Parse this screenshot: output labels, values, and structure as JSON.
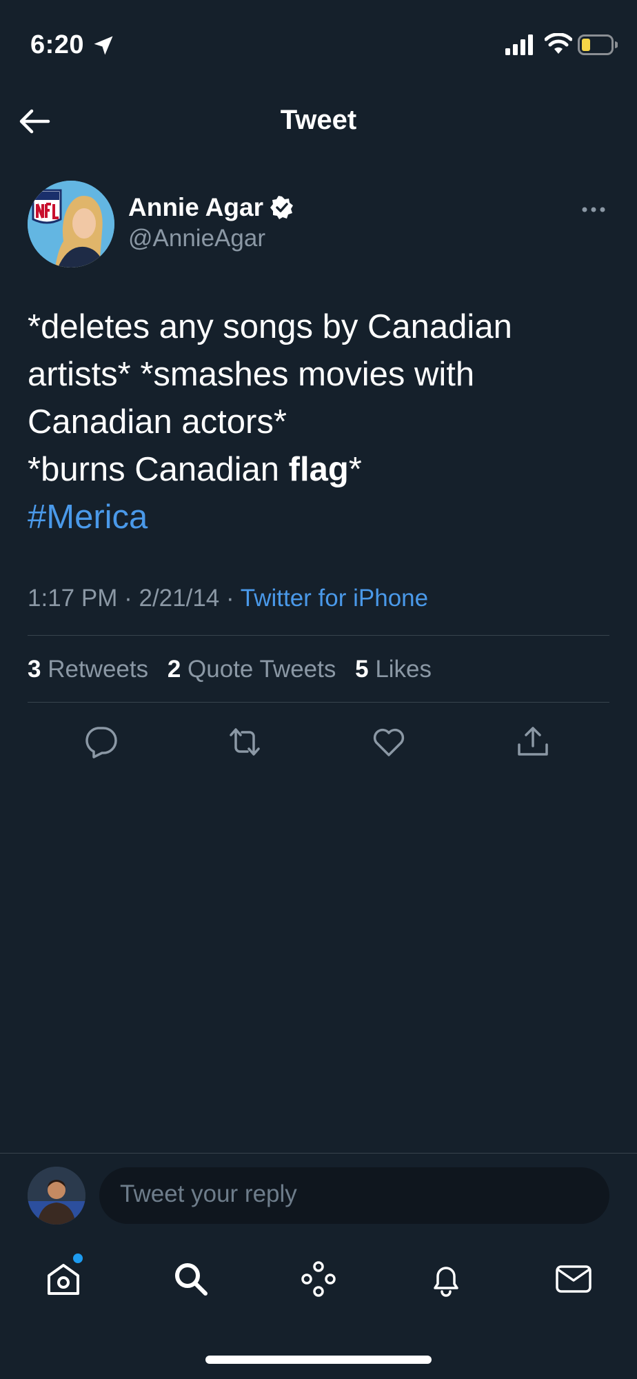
{
  "status_bar": {
    "time": "6:20",
    "icons": [
      "location-arrow-icon",
      "cellular-signal-icon",
      "wifi-icon",
      "battery-low-icon"
    ],
    "battery_color": "#f5d547"
  },
  "header": {
    "title": "Tweet",
    "back_icon": "arrow-left-icon"
  },
  "tweet": {
    "author_name": "Annie Agar",
    "author_handle": "@AnnieAgar",
    "verified": true,
    "text_lines": [
      "*deletes any songs by Canadian",
      "artists* *smashes movies with",
      "Canadian actors*"
    ],
    "line4_before": "*burns Canadian ",
    "line4_bold": "flag",
    "line4_after": "*",
    "hashtag": "#Merica",
    "time": "1:17 PM",
    "date": "2/21/14",
    "sep": "·",
    "source": "Twitter for iPhone"
  },
  "stats": {
    "retweets_count": "3",
    "retweets_label": "Retweets",
    "quotes_count": "2",
    "quotes_label": "Quote Tweets",
    "likes_count": "5",
    "likes_label": "Likes"
  },
  "actions": [
    "reply-icon",
    "retweet-icon",
    "like-icon",
    "share-icon"
  ],
  "reply": {
    "placeholder": "Tweet your reply"
  },
  "tab_bar": {
    "items": [
      "home-icon",
      "search-icon",
      "spaces-icon",
      "notifications-icon",
      "messages-icon"
    ],
    "notification_dot_color": "#1d9bf0"
  },
  "colors": {
    "background": "#15202b",
    "accent": "#4a99e9",
    "secondary_text": "#8b98a5",
    "divider": "#38444d"
  }
}
